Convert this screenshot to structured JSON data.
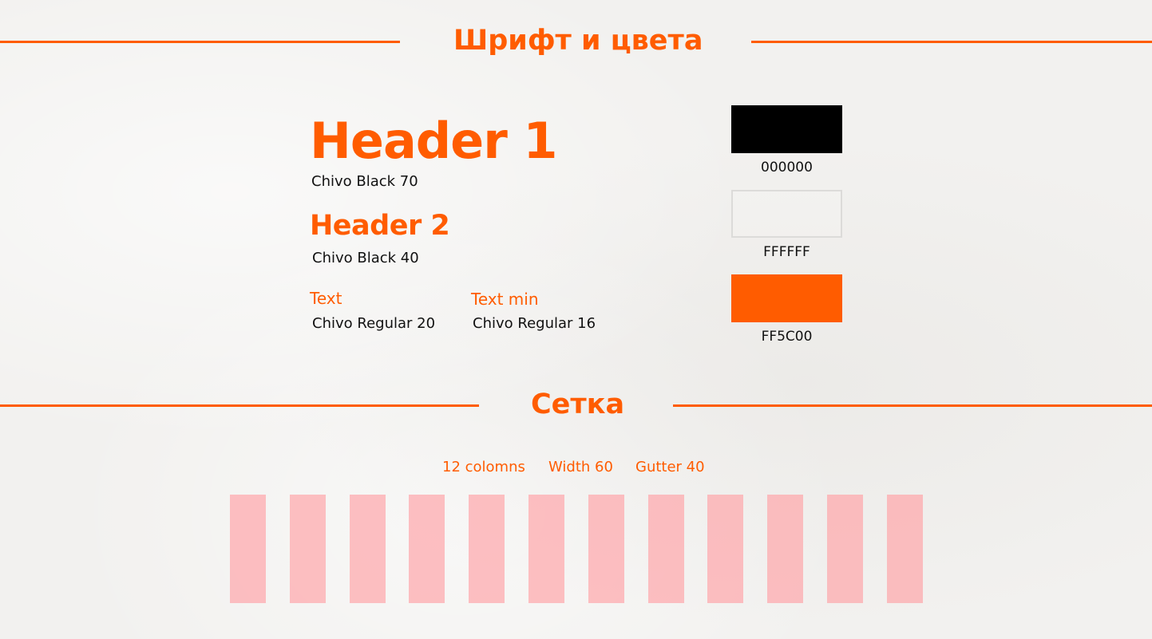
{
  "sections": {
    "fonts_colors_title": "Шрифт и цвета",
    "grid_title": "Сетка"
  },
  "typography": {
    "header1": {
      "sample": "Header 1",
      "caption": "Chivo Black 70"
    },
    "header2": {
      "sample": "Header 2",
      "caption": "Chivo Black 40"
    },
    "text": {
      "sample": "Text",
      "caption": "Chivo Regular 20"
    },
    "text_min": {
      "sample": "Text min",
      "caption": "Chivo Regular 16"
    }
  },
  "colors": [
    {
      "hex": "#000000",
      "label": "000000"
    },
    {
      "hex": "#FFFFFF",
      "label": "FFFFFF"
    },
    {
      "hex": "#FF5C00",
      "label": "FF5C00"
    }
  ],
  "accent_color": "#FF5C00",
  "grid": {
    "columns_label": "12 colomns",
    "width_label": "Width 60",
    "gutter_label": "Gutter 40",
    "column_count": 12,
    "column_color": "#FFB4B7"
  }
}
